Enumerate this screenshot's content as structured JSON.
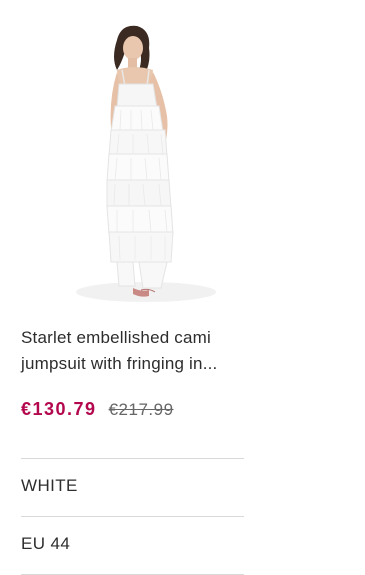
{
  "product": {
    "image_alt": "Model wearing white tiered fringed cami jumpsuit",
    "title_line1": "Starlet embellished cami",
    "title_line2": "jumpsuit with fringing in...",
    "price_current": "€130.79",
    "price_previous": "€217.99",
    "price_color": "#b3084d"
  },
  "attributes": {
    "colour": "WHITE",
    "size": "EU 44"
  }
}
